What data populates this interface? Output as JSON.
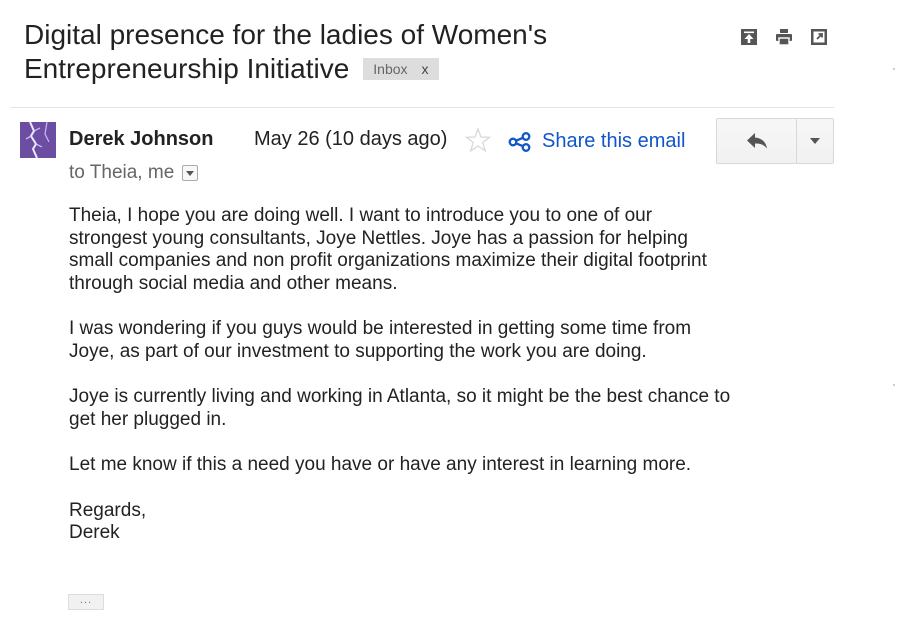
{
  "subject": {
    "line1": "Digital presence for the ladies of Women's",
    "line2": "Entrepreneurship Initiative",
    "label": "Inbox",
    "label_close": "x"
  },
  "top_icons": [
    "expand-all-icon",
    "print-icon",
    "new-window-icon"
  ],
  "message": {
    "sender": "Derek Johnson",
    "date": "May 26 (10 days ago)",
    "share_label": "Share this email",
    "recipients": "to Theia, me",
    "paragraphs": [
      [
        "Theia, I hope you are doing well.  I want to introduce you to one of our",
        "strongest young consultants, Joye Nettles.  Joye has a passion for helping",
        "small companies and non profit organizations maximize their digital footprint",
        "through social media and other means."
      ],
      [
        "I was wondering if you guys would be interested in getting some time from",
        "Joye, as part of our investment to supporting the work you are doing."
      ],
      [
        "Joye is currently living and working in Atlanta, so it might be the best chance to",
        "get her plugged in."
      ],
      [
        "Let me know if this a need you have or have any interest in learning more."
      ],
      [
        "Regards,",
        "Derek"
      ]
    ],
    "trimmed_content": "..."
  },
  "colors": {
    "link": "#1155cc",
    "label_bg": "#dddddd",
    "avatar": "#6b4fa0"
  }
}
